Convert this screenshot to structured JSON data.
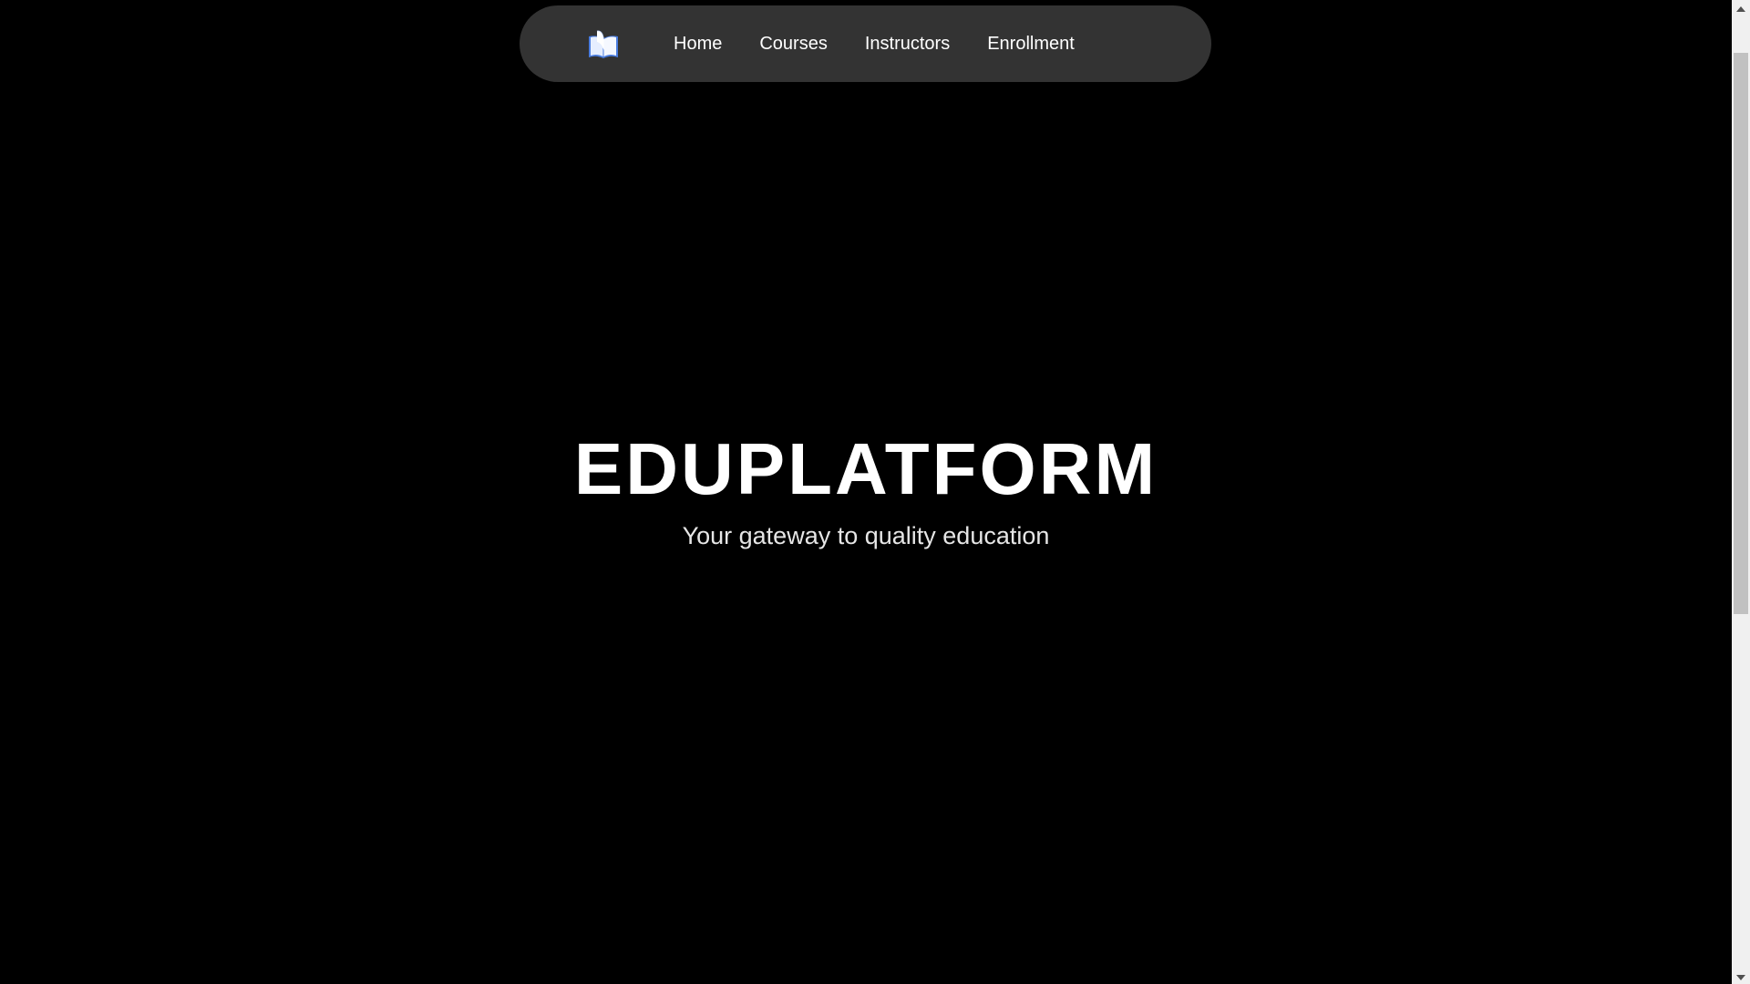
{
  "nav": {
    "logo_icon": "open-book-icon",
    "links": [
      {
        "label": "Home"
      },
      {
        "label": "Courses"
      },
      {
        "label": "Instructors"
      },
      {
        "label": "Enrollment"
      }
    ]
  },
  "hero": {
    "title": "EDUPLATFORM",
    "subtitle": "Your gateway to quality education"
  },
  "colors": {
    "background": "#000000",
    "nav_background": "#333333",
    "text": "#ffffff",
    "logo_book": "#dfe9ff",
    "logo_book_edge": "#4a7de0"
  },
  "scrollbar": {
    "up_icon": "scroll-up-arrow-icon",
    "down_icon": "scroll-down-arrow-icon"
  }
}
